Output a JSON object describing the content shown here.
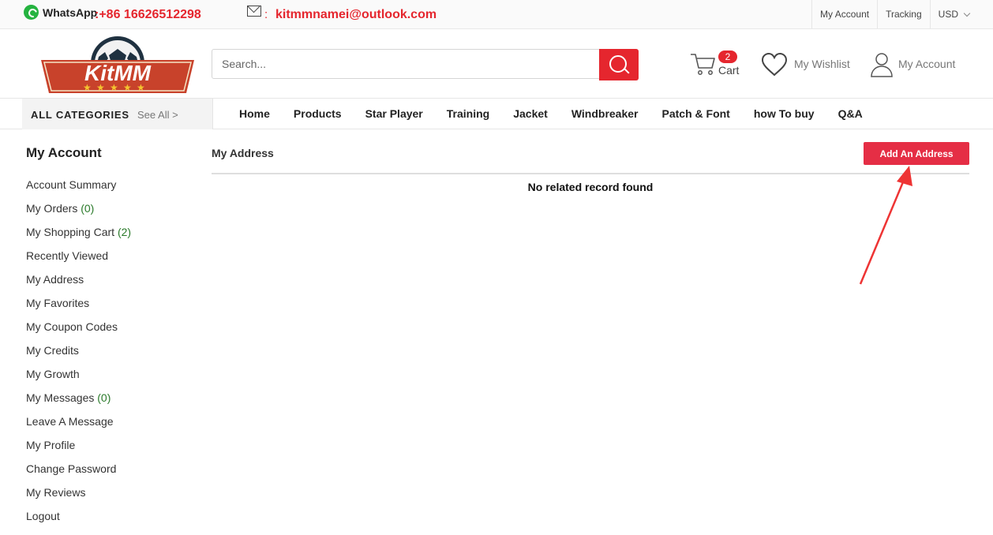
{
  "topbar": {
    "whatsapp_label": "WhatsApp",
    "phone": ":+86 16626512298",
    "mail_colon": ":",
    "email": "kitmmnamei@outlook.com",
    "links": [
      "My Account",
      "Tracking",
      "USD"
    ]
  },
  "header": {
    "logo_text": "KitMM",
    "search_placeholder": "Search...",
    "cart_count": "2",
    "cart_label": "Cart",
    "wishlist_label": "My Wishlist",
    "account_label": "My Account"
  },
  "nav": {
    "categories_label": "ALL CATEGORIES",
    "see_all": "See All >",
    "items": [
      "Home",
      "Products",
      "Star Player",
      "Training",
      "Jacket",
      "Windbreaker",
      "Patch & Font",
      "how To buy",
      "Q&A"
    ]
  },
  "sidebar": {
    "title": "My Account",
    "items": [
      {
        "label": "Account Summary",
        "count": ""
      },
      {
        "label": "My Orders ",
        "count": "(0)"
      },
      {
        "label": "My Shopping Cart ",
        "count": "(2)"
      },
      {
        "label": "Recently Viewed",
        "count": ""
      },
      {
        "label": "My Address",
        "count": ""
      },
      {
        "label": "My Favorites",
        "count": ""
      },
      {
        "label": "My Coupon Codes",
        "count": ""
      },
      {
        "label": "My Credits",
        "count": ""
      },
      {
        "label": "My Growth",
        "count": ""
      },
      {
        "label": "My Messages ",
        "count": "(0)"
      },
      {
        "label": "Leave A Message",
        "count": ""
      },
      {
        "label": "My Profile",
        "count": ""
      },
      {
        "label": "Change Password",
        "count": ""
      },
      {
        "label": "My Reviews",
        "count": ""
      },
      {
        "label": "Logout",
        "count": ""
      }
    ]
  },
  "main": {
    "title": "My Address",
    "add_button": "Add An Address",
    "empty_message": "No related record found"
  },
  "colors": {
    "accent": "#e5262e",
    "button": "#e52e45",
    "whatsapp": "#25b340"
  }
}
